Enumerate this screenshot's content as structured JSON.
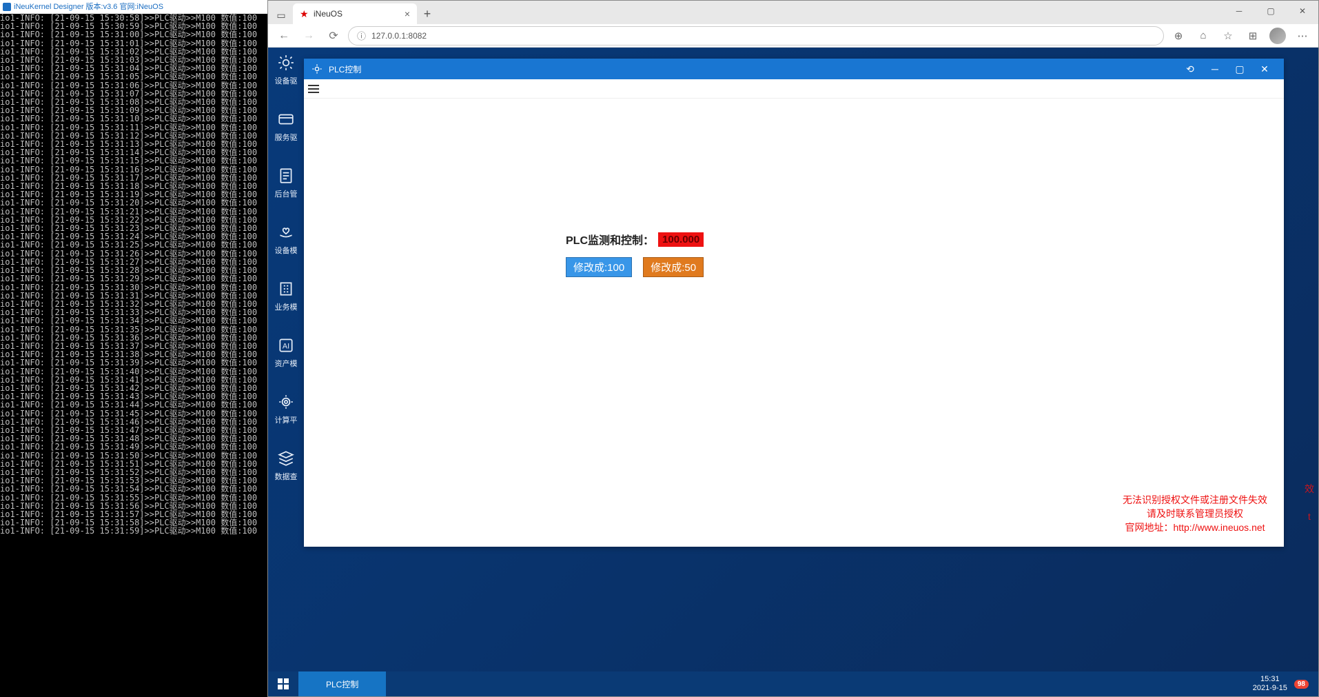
{
  "console": {
    "title": "iNeuKernel Designer 版本:v3.6 官网:iNeuOS",
    "line_prefix": "io1-INFO:",
    "date": "21-09-15",
    "time_start_sec": 58,
    "time_start_min": 30,
    "msg1": ">>PLC驱动>>M100",
    "msg2": "数值:100"
  },
  "browser": {
    "tab_title": "iNeuOS",
    "url": "127.0.0.1:8082"
  },
  "sidebar": {
    "items": [
      {
        "label": "设备驱"
      },
      {
        "label": "服务驱"
      },
      {
        "label": "后台管"
      },
      {
        "label": "设备模"
      },
      {
        "label": "业务模"
      },
      {
        "label": "资产模"
      },
      {
        "label": "计算平"
      },
      {
        "label": "数据查"
      }
    ]
  },
  "window": {
    "title": "PLC控制"
  },
  "plc": {
    "label": "PLC监测和控制：",
    "value": "100.000",
    "btn100": "修改成:100",
    "btn50": "修改成:50"
  },
  "license": {
    "line1": "无法识别授权文件或注册文件失效",
    "line2": "请及时联系管理员授权",
    "line3_prefix": "官网地址：",
    "line3_url": "http://www.ineuos.net"
  },
  "taskbar": {
    "item": "PLC控制",
    "time": "15:31",
    "date": "2021-9-15",
    "badge": "98"
  }
}
